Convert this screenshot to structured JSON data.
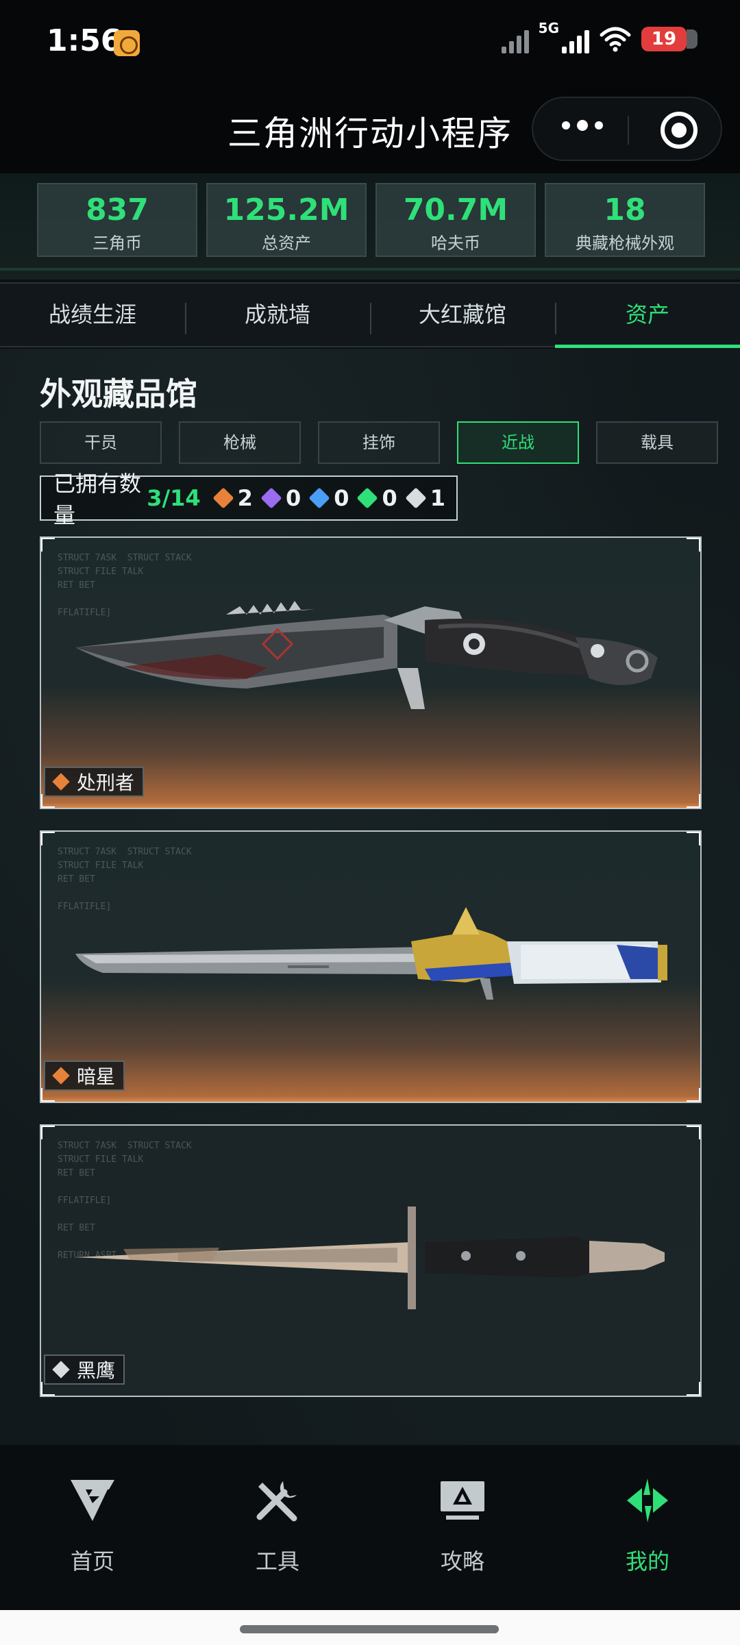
{
  "status_bar": {
    "time": "1:56",
    "network": "5G",
    "battery": "19"
  },
  "title_bar": {
    "title": "三角洲行动小程序"
  },
  "stats": [
    {
      "value": "837",
      "label": "三角币"
    },
    {
      "value": "125.2M",
      "label": "总资产"
    },
    {
      "value": "70.7M",
      "label": "哈夫币"
    },
    {
      "value": "18",
      "label": "典藏枪械外观"
    }
  ],
  "tabs": [
    {
      "label": "战绩生涯",
      "active": false
    },
    {
      "label": "成就墙",
      "active": false
    },
    {
      "label": "大红藏馆",
      "active": false
    },
    {
      "label": "资产",
      "active": true
    }
  ],
  "section": {
    "title": "外观藏品馆",
    "categories": [
      {
        "label": "干员",
        "active": false
      },
      {
        "label": "枪械",
        "active": false
      },
      {
        "label": "挂饰",
        "active": false
      },
      {
        "label": "近战",
        "active": true
      },
      {
        "label": "载具",
        "active": false
      }
    ],
    "owned": {
      "label": "已拥有数量",
      "value": "3/14",
      "rarities": [
        {
          "color": "#e8823a",
          "count": "2"
        },
        {
          "color": "#9b6bf0",
          "count": "0"
        },
        {
          "color": "#4a9ef5",
          "count": "0"
        },
        {
          "color": "#2fe079",
          "count": "0"
        },
        {
          "color": "#d9dde0",
          "count": "1"
        }
      ]
    }
  },
  "items": [
    {
      "name": "处刑者",
      "rarity_color": "#e8823a"
    },
    {
      "name": "暗星",
      "rarity_color": "#e8823a"
    },
    {
      "name": "黑鹰",
      "rarity_color": "#d9dde0"
    }
  ],
  "nav": [
    {
      "label": "首页",
      "icon": "home-logo-icon",
      "active": false
    },
    {
      "label": "工具",
      "icon": "tools-icon",
      "active": false
    },
    {
      "label": "攻略",
      "icon": "guide-monitor-icon",
      "active": false
    },
    {
      "label": "我的",
      "icon": "profile-logo-icon",
      "active": true
    }
  ],
  "colors": {
    "accent": "#2fe079",
    "background": "#12191c"
  }
}
